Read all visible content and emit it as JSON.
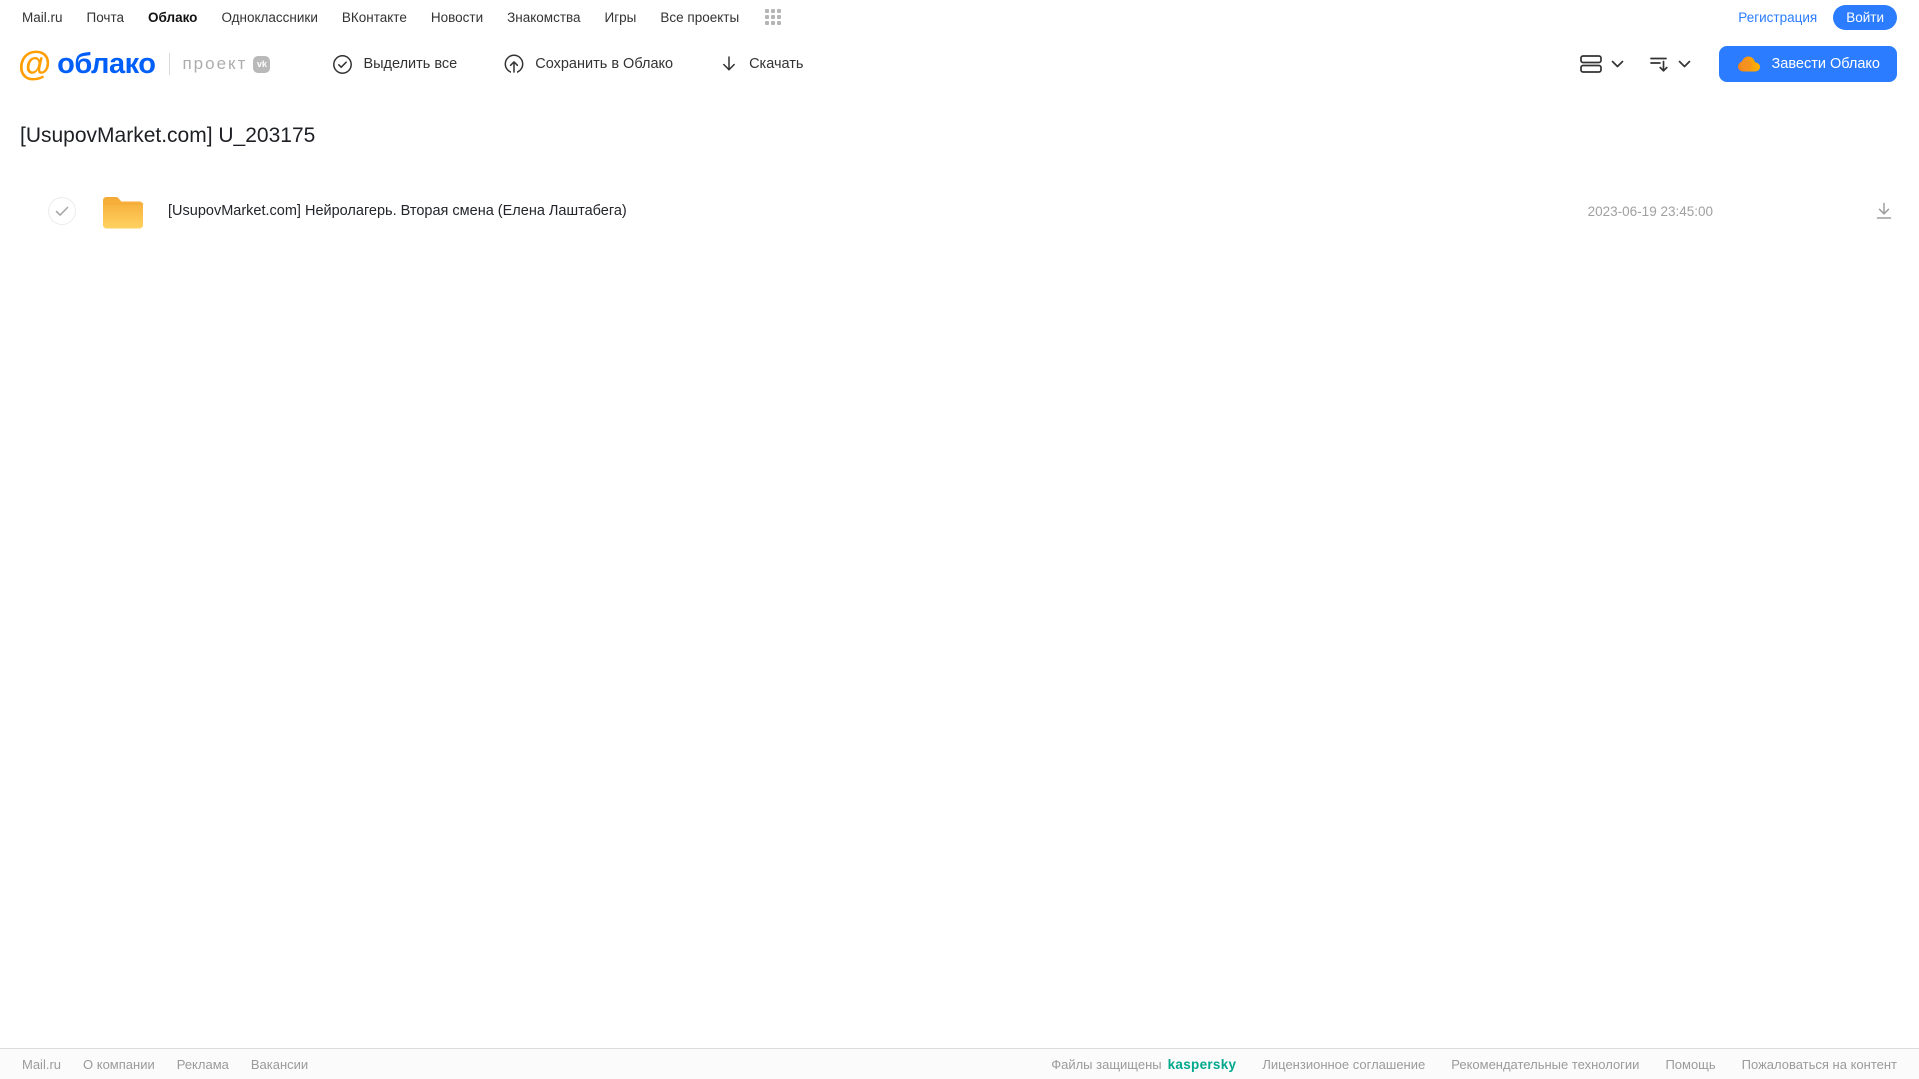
{
  "topbar": {
    "links": [
      "Mail.ru",
      "Почта",
      "Облако",
      "Одноклассники",
      "ВКонтакте",
      "Новости",
      "Знакомства",
      "Игры",
      "Все проекты"
    ],
    "active_link": "Облако",
    "registration_label": "Регистрация",
    "login_label": "Войти"
  },
  "header": {
    "logo_at": "@",
    "logo_word": "облако",
    "project_label": "проект",
    "vk_badge": "vk",
    "toolbar": {
      "select_all_label": "Выделить все",
      "save_to_cloud_label": "Сохранить в Облако",
      "download_label": "Скачать"
    },
    "get_cloud_label": "Завести Облако"
  },
  "main": {
    "title": "[UsupovMarket.com] U_203175",
    "files": [
      {
        "type": "folder",
        "name": "[UsupovMarket.com] Нейролагерь. Вторая смена (Елена Лаштабега)",
        "date": "2023-06-19 23:45:00"
      }
    ]
  },
  "footer": {
    "left_links": [
      "Mail.ru",
      "О компании",
      "Реклама",
      "Вакансии"
    ],
    "protected_label": "Файлы защищены",
    "kaspersky_label": "kaspersky",
    "right_links": [
      "Лицензионное соглашение",
      "Рекомендательные технологии",
      "Помощь",
      "Пожаловаться на контент"
    ]
  },
  "colors": {
    "accent_blue": "#2b7cff",
    "logo_orange": "#ff9e00",
    "logo_blue": "#005ff9",
    "kaspersky_teal": "#00a88e",
    "folder_yellow_top": "#f7ab37",
    "folder_yellow_bottom": "#ffd261"
  }
}
